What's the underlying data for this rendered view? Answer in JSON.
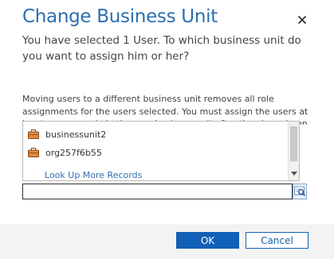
{
  "dialog": {
    "title": "Change Business Unit",
    "subtitle": "You have selected 1 User. To which business unit do you want to assign him or her?",
    "warning": "Moving users to a different business unit removes all role assignments for the users selected. You must assign the users at least one new role in the new business unit after they have been moved to the new business unit."
  },
  "lookup": {
    "results": [
      {
        "label": "businessunit2",
        "icon": "business-unit-icon"
      },
      {
        "label": "org257f6b55",
        "icon": "business-unit-icon"
      }
    ],
    "more_link": "Look Up More Records",
    "input_value": "",
    "search_icon": "lookup-search-icon"
  },
  "buttons": {
    "ok": "OK",
    "cancel": "Cancel"
  },
  "colors": {
    "title": "#2b6fb0",
    "primary": "#1160b7",
    "link": "#2f6fb1",
    "footer": "#f3f3f3"
  }
}
